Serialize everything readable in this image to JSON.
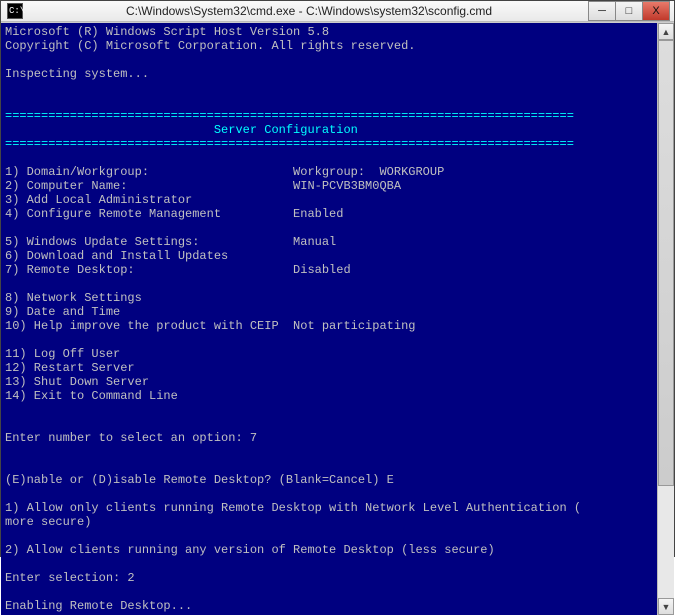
{
  "titlebar": {
    "icon_label": "C:\\",
    "title": "C:\\Windows\\System32\\cmd.exe - C:\\Windows\\system32\\sconfig.cmd",
    "minimize": "─",
    "maximize": "□",
    "close": "X"
  },
  "term": {
    "line1": "Microsoft (R) Windows Script Host Version 5.8",
    "line2": "Copyright (C) Microsoft Corporation. All rights reserved.",
    "inspecting": "Inspecting system...",
    "divider1": "===============================================================================",
    "header": "                             Server Configuration",
    "divider2": "===============================================================================",
    "opt1": "1) Domain/Workgroup:                    Workgroup:  WORKGROUP",
    "opt2": "2) Computer Name:                       WIN-PCVB3BM0QBA",
    "opt3": "3) Add Local Administrator",
    "opt4": "4) Configure Remote Management          Enabled",
    "opt5": "5) Windows Update Settings:             Manual",
    "opt6": "6) Download and Install Updates",
    "opt7": "7) Remote Desktop:                      Disabled",
    "opt8": "8) Network Settings",
    "opt9": "9) Date and Time",
    "opt10": "10) Help improve the product with CEIP  Not participating",
    "opt11": "11) Log Off User",
    "opt12": "12) Restart Server",
    "opt13": "13) Shut Down Server",
    "opt14": "14) Exit to Command Line",
    "prompt1": "Enter number to select an option: 7",
    "q1": "(E)nable or (D)isable Remote Desktop? (Blank=Cancel) E",
    "c1a": "1) Allow only clients running Remote Desktop with Network Level Authentication (",
    "c1b": "more secure)",
    "c2": "2) Allow clients running any version of Remote Desktop (less secure)",
    "sel": "Enter selection: 2",
    "enabling": "Enabling Remote Desktop..."
  },
  "scroll": {
    "up": "▲",
    "down": "▼"
  }
}
